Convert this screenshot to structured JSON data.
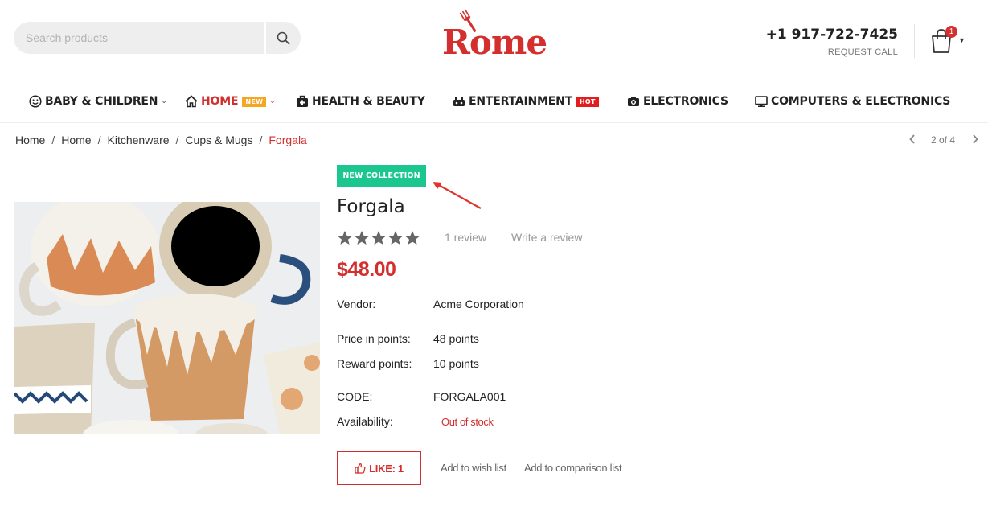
{
  "header": {
    "search_placeholder": "Search products",
    "logo_text": "Rome",
    "phone": "+1 917-722-7425",
    "request_call": "REQUEST CALL",
    "cart_count": "1"
  },
  "nav": {
    "items": [
      {
        "label": "BABY & CHILDREN",
        "icon": "smile-icon",
        "has_caret": true
      },
      {
        "label": "HOME",
        "icon": "house-icon",
        "tag": "NEW",
        "has_caret": true
      },
      {
        "label": "HEALTH & BEAUTY",
        "icon": "medkit-icon"
      },
      {
        "label": "ENTERTAINMENT",
        "icon": "gamepad-icon",
        "tag": "HOT"
      },
      {
        "label": "ELECTRONICS",
        "icon": "camera-icon"
      },
      {
        "label": "COMPUTERS & ELECTRONICS",
        "icon": "monitor-icon"
      }
    ]
  },
  "breadcrumb": {
    "items": [
      "Home",
      "Home",
      "Kitchenware",
      "Cups & Mugs"
    ],
    "separator": "/",
    "current": "Forgala"
  },
  "pager": {
    "label": "2 of 4"
  },
  "product": {
    "badge": "NEW COLLECTION",
    "title": "Forgala",
    "rating": 5,
    "review_count": "1 review",
    "write_review": "Write a review",
    "price": "$48.00",
    "vendor_label": "Vendor:",
    "vendor": "Acme Corporation",
    "price_points_label": "Price in points:",
    "price_points": "48 points",
    "reward_points_label": "Reward points:",
    "reward_points": "10 points",
    "code_label": "CODE:",
    "code": "FORGALA001",
    "availability_label": "Availability:",
    "availability": "Out of stock",
    "like_label": "LIKE: 1",
    "wishlist_label": "Add to wish list",
    "compare_label": "Add to comparison list"
  },
  "colors": {
    "brand_red": "#d32f2f",
    "badge_green": "#1bc78f",
    "new_tag": "#f5a623",
    "hot_tag": "#e31d1d"
  }
}
